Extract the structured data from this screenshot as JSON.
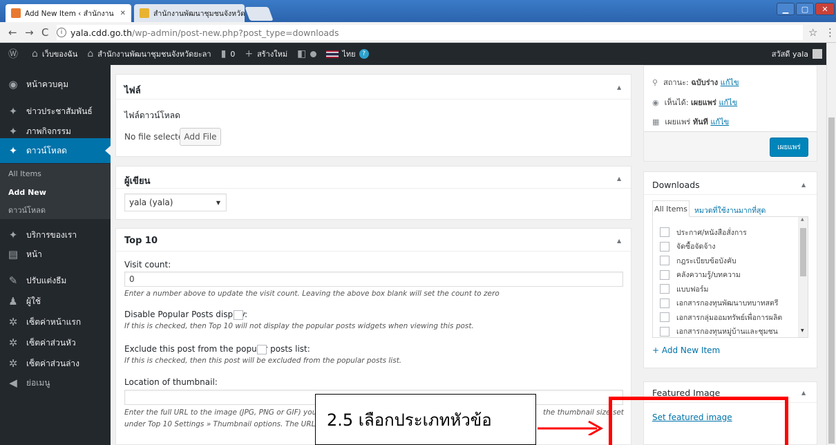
{
  "browser": {
    "tabs": [
      {
        "title": "Add New Item ‹ สำนักงาน",
        "active": true
      },
      {
        "title": "สำนักงานพัฒนาชุมชนจังหวัด",
        "active": false
      }
    ],
    "url_host": "yala.cdd.go.th",
    "url_path": "/wp-admin/post-new.php?post_type=downloads"
  },
  "adminbar": {
    "my_sites": "เว็บของฉัน",
    "site_name": "สำนักงานพัฒนาชุมชนจังหวัดยะลา",
    "comments": "0",
    "new": "สร้างใหม่",
    "lang": "ไทย",
    "greeting": "สวัสดี yala"
  },
  "sidebar": {
    "items": [
      {
        "label": "หน้าควบคุม"
      },
      {
        "label": "ข่าวประชาสัมพันธ์"
      },
      {
        "label": "ภาพกิจกรรม"
      },
      {
        "label": "ดาวน์โหลด"
      },
      {
        "label": "บริการของเรา"
      },
      {
        "label": "หน้า"
      },
      {
        "label": "ปรับแต่งธีม"
      },
      {
        "label": "ผู้ใช้"
      },
      {
        "label": "เซ็ตค่าหน้าแรก"
      },
      {
        "label": "เซ็ตค่าส่วนหัว"
      },
      {
        "label": "เซ็ตค่าส่วนล่าง"
      },
      {
        "label": "ย่อเมนู"
      }
    ],
    "submenu": [
      "All Items",
      "Add New",
      "ดาวน์โหลด"
    ]
  },
  "file_box": {
    "title": "ไฟล์",
    "label": "ไฟล์ดาวน์โหลด",
    "status": "No file selected",
    "button": "Add File"
  },
  "author_box": {
    "title": "ผู้เขียน",
    "selected": "yala (yala)"
  },
  "top10_box": {
    "title": "Top 10",
    "visit_label": "Visit count:",
    "visit_value": "0",
    "visit_help": "Enter a number above to update the visit count. Leaving the above box blank will set the count to zero",
    "disable_label": "Disable Popular Posts display:",
    "disable_help": "If this is checked, then Top 10 will not display the popular posts widgets when viewing this post.",
    "exclude_label": "Exclude this post from the popular posts list:",
    "exclude_help": "If this is checked, then this post will be excluded from the popular posts list.",
    "thumb_label": "Location of thumbnail:",
    "thumb_help_1": "Enter the full URL to the image (JPG, PNG or GIF) you'd",
    "thumb_help_1b": "the thumbnail size set",
    "thumb_help_2": "under Top 10 Settings » Thumbnail options. The URL ab"
  },
  "publish_box": {
    "status_label": "สถานะ:",
    "status_value": "ฉบับร่าง",
    "visibility_label": "เห็นได้:",
    "visibility_value": "เผยแพร่",
    "publish_label": "เผยแพร่",
    "publish_value": "ทันที",
    "edit": "แก้ไข",
    "button": "เผยแพร่"
  },
  "downloads_box": {
    "title": "Downloads",
    "tab_all": "All Items",
    "tab_popular": "หมวดที่ใช้งานมากที่สุด",
    "categories": [
      "ประกาศ/หนังสือสั่งการ",
      "จัดซื้อจัดจ้าง",
      "กฎระเบียบข้อบังคับ",
      "คลังความรู้/บทความ",
      "แบบฟอร์ม",
      "เอกสารกองทุนพัฒนาบทบาทสตรี",
      "เอกสารกลุ่มออมทรัพย์เพื่อการผลิต",
      "เอกสารกองทุนหมู่บ้านและชุมชน"
    ],
    "add_new": "+ Add New Item"
  },
  "featured_box": {
    "title": "Featured Image",
    "link": "Set featured image"
  },
  "annotation": {
    "text": "2.5 เลือกประเภทหัวข้อ",
    "color": "#ff0000"
  }
}
